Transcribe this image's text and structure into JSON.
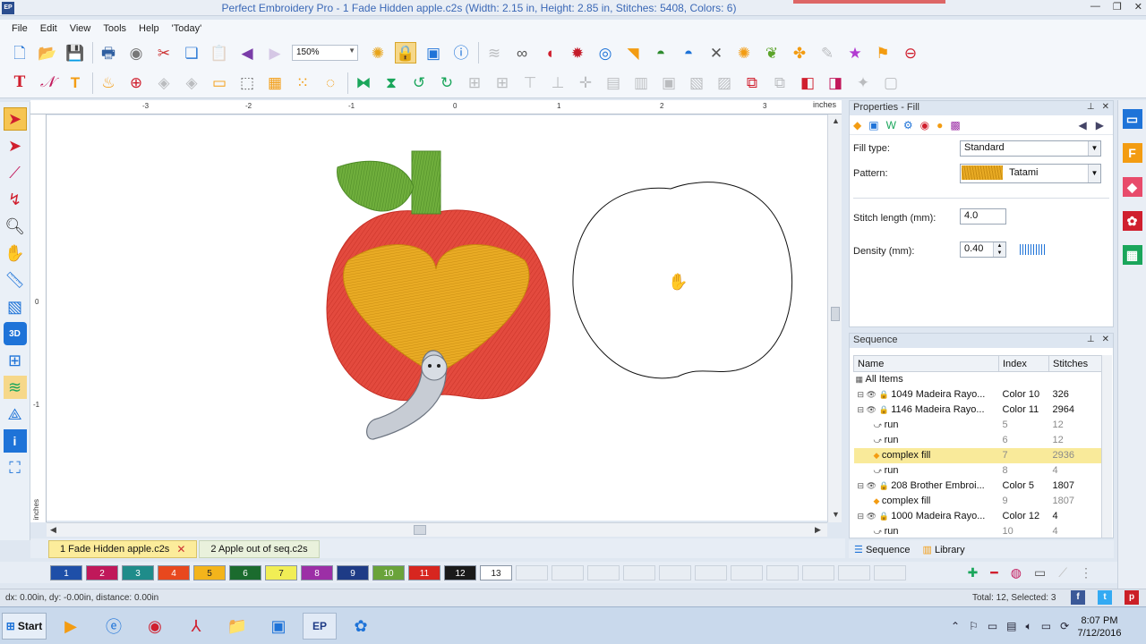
{
  "window": {
    "title": "Perfect Embroidery Pro - 1 Fade Hidden apple.c2s (Width: 2.15 in, Height: 2.85 in, Stitches: 5408, Colors: 6)",
    "app_icon": "EP"
  },
  "menu": [
    "File",
    "Edit",
    "View",
    "Tools",
    "Help",
    "'Today'"
  ],
  "toolbar": {
    "zoom_value": "150%"
  },
  "ruler": {
    "unit_label": "inches",
    "top_ticks": [
      "-3",
      "-2",
      "-1",
      "0",
      "1",
      "2",
      "3"
    ],
    "left_ticks": [
      "0",
      "-1"
    ],
    "left_unit": "inches"
  },
  "properties": {
    "header": "Properties - Fill",
    "fill_type_label": "Fill type:",
    "fill_type_value": "Standard",
    "pattern_label": "Pattern:",
    "pattern_value": "Tatami",
    "stitch_length_label": "Stitch length (mm):",
    "stitch_length_value": "4.0",
    "density_label": "Density (mm):",
    "density_value": "0.40"
  },
  "sequence": {
    "header": "Sequence",
    "columns": [
      "Name",
      "Index",
      "Stitches"
    ],
    "rows": [
      {
        "name": "All Items",
        "index": "",
        "stitches": "",
        "level": 0,
        "dim": false,
        "highlight": false
      },
      {
        "name": "1049 Madeira Rayo...",
        "index": "Color 10",
        "stitches": "326",
        "level": 1,
        "dim": false,
        "highlight": false
      },
      {
        "name": "1146 Madeira Rayo...",
        "index": "Color 11",
        "stitches": "2964",
        "level": 1,
        "dim": false,
        "highlight": false
      },
      {
        "name": "run",
        "index": "5",
        "stitches": "12",
        "level": 2,
        "dim": true,
        "highlight": false
      },
      {
        "name": "run",
        "index": "6",
        "stitches": "12",
        "level": 2,
        "dim": true,
        "highlight": false
      },
      {
        "name": "complex fill",
        "index": "7",
        "stitches": "2936",
        "level": 2,
        "dim": true,
        "highlight": true
      },
      {
        "name": "run",
        "index": "8",
        "stitches": "4",
        "level": 2,
        "dim": true,
        "highlight": false
      },
      {
        "name": "208 Brother Embroi...",
        "index": "Color 5",
        "stitches": "1807",
        "level": 1,
        "dim": false,
        "highlight": false
      },
      {
        "name": "complex fill",
        "index": "9",
        "stitches": "1807",
        "level": 2,
        "dim": true,
        "highlight": false
      },
      {
        "name": "1000 Madeira Rayo...",
        "index": "Color 12",
        "stitches": "4",
        "level": 1,
        "dim": false,
        "highlight": false
      },
      {
        "name": "run",
        "index": "10",
        "stitches": "4",
        "level": 2,
        "dim": true,
        "highlight": false
      }
    ],
    "tabs": [
      "Sequence",
      "Library"
    ]
  },
  "doc_tabs": [
    "1 Fade Hidden apple.c2s",
    "2 Apple out of seq.c2s"
  ],
  "color_swatches": [
    {
      "label": "1",
      "color": "#1e4fa8"
    },
    {
      "label": "2",
      "color": "#c0185a"
    },
    {
      "label": "3",
      "color": "#1f8c8a"
    },
    {
      "label": "4",
      "color": "#e8481e"
    },
    {
      "label": "5",
      "color": "#f3b41b"
    },
    {
      "label": "6",
      "color": "#1b6b2e"
    },
    {
      "label": "7",
      "color": "#f1ee55"
    },
    {
      "label": "8",
      "color": "#9c2fa6"
    },
    {
      "label": "9",
      "color": "#1e3b86"
    },
    {
      "label": "10",
      "color": "#6aa33a"
    },
    {
      "label": "11",
      "color": "#d7261f"
    },
    {
      "label": "12",
      "color": "#1a1a1a"
    },
    {
      "label": "13",
      "color": "#ffffff"
    }
  ],
  "status": {
    "left": "dx: 0.00in, dy: -0.00in, distance: 0.00in",
    "right": "Total: 12, Selected: 3"
  },
  "taskbar": {
    "start_label": "Start",
    "pep_label": "EP",
    "time": "8:07 PM",
    "date": "7/12/2016"
  },
  "icons": [
    "select-arrow-icon",
    "zoom-icon",
    "pan-hand-icon",
    "lock-icon",
    "info-icon",
    "text-icon",
    "heart-icon",
    "star-icon",
    "grab-hand-cursor-icon"
  ]
}
